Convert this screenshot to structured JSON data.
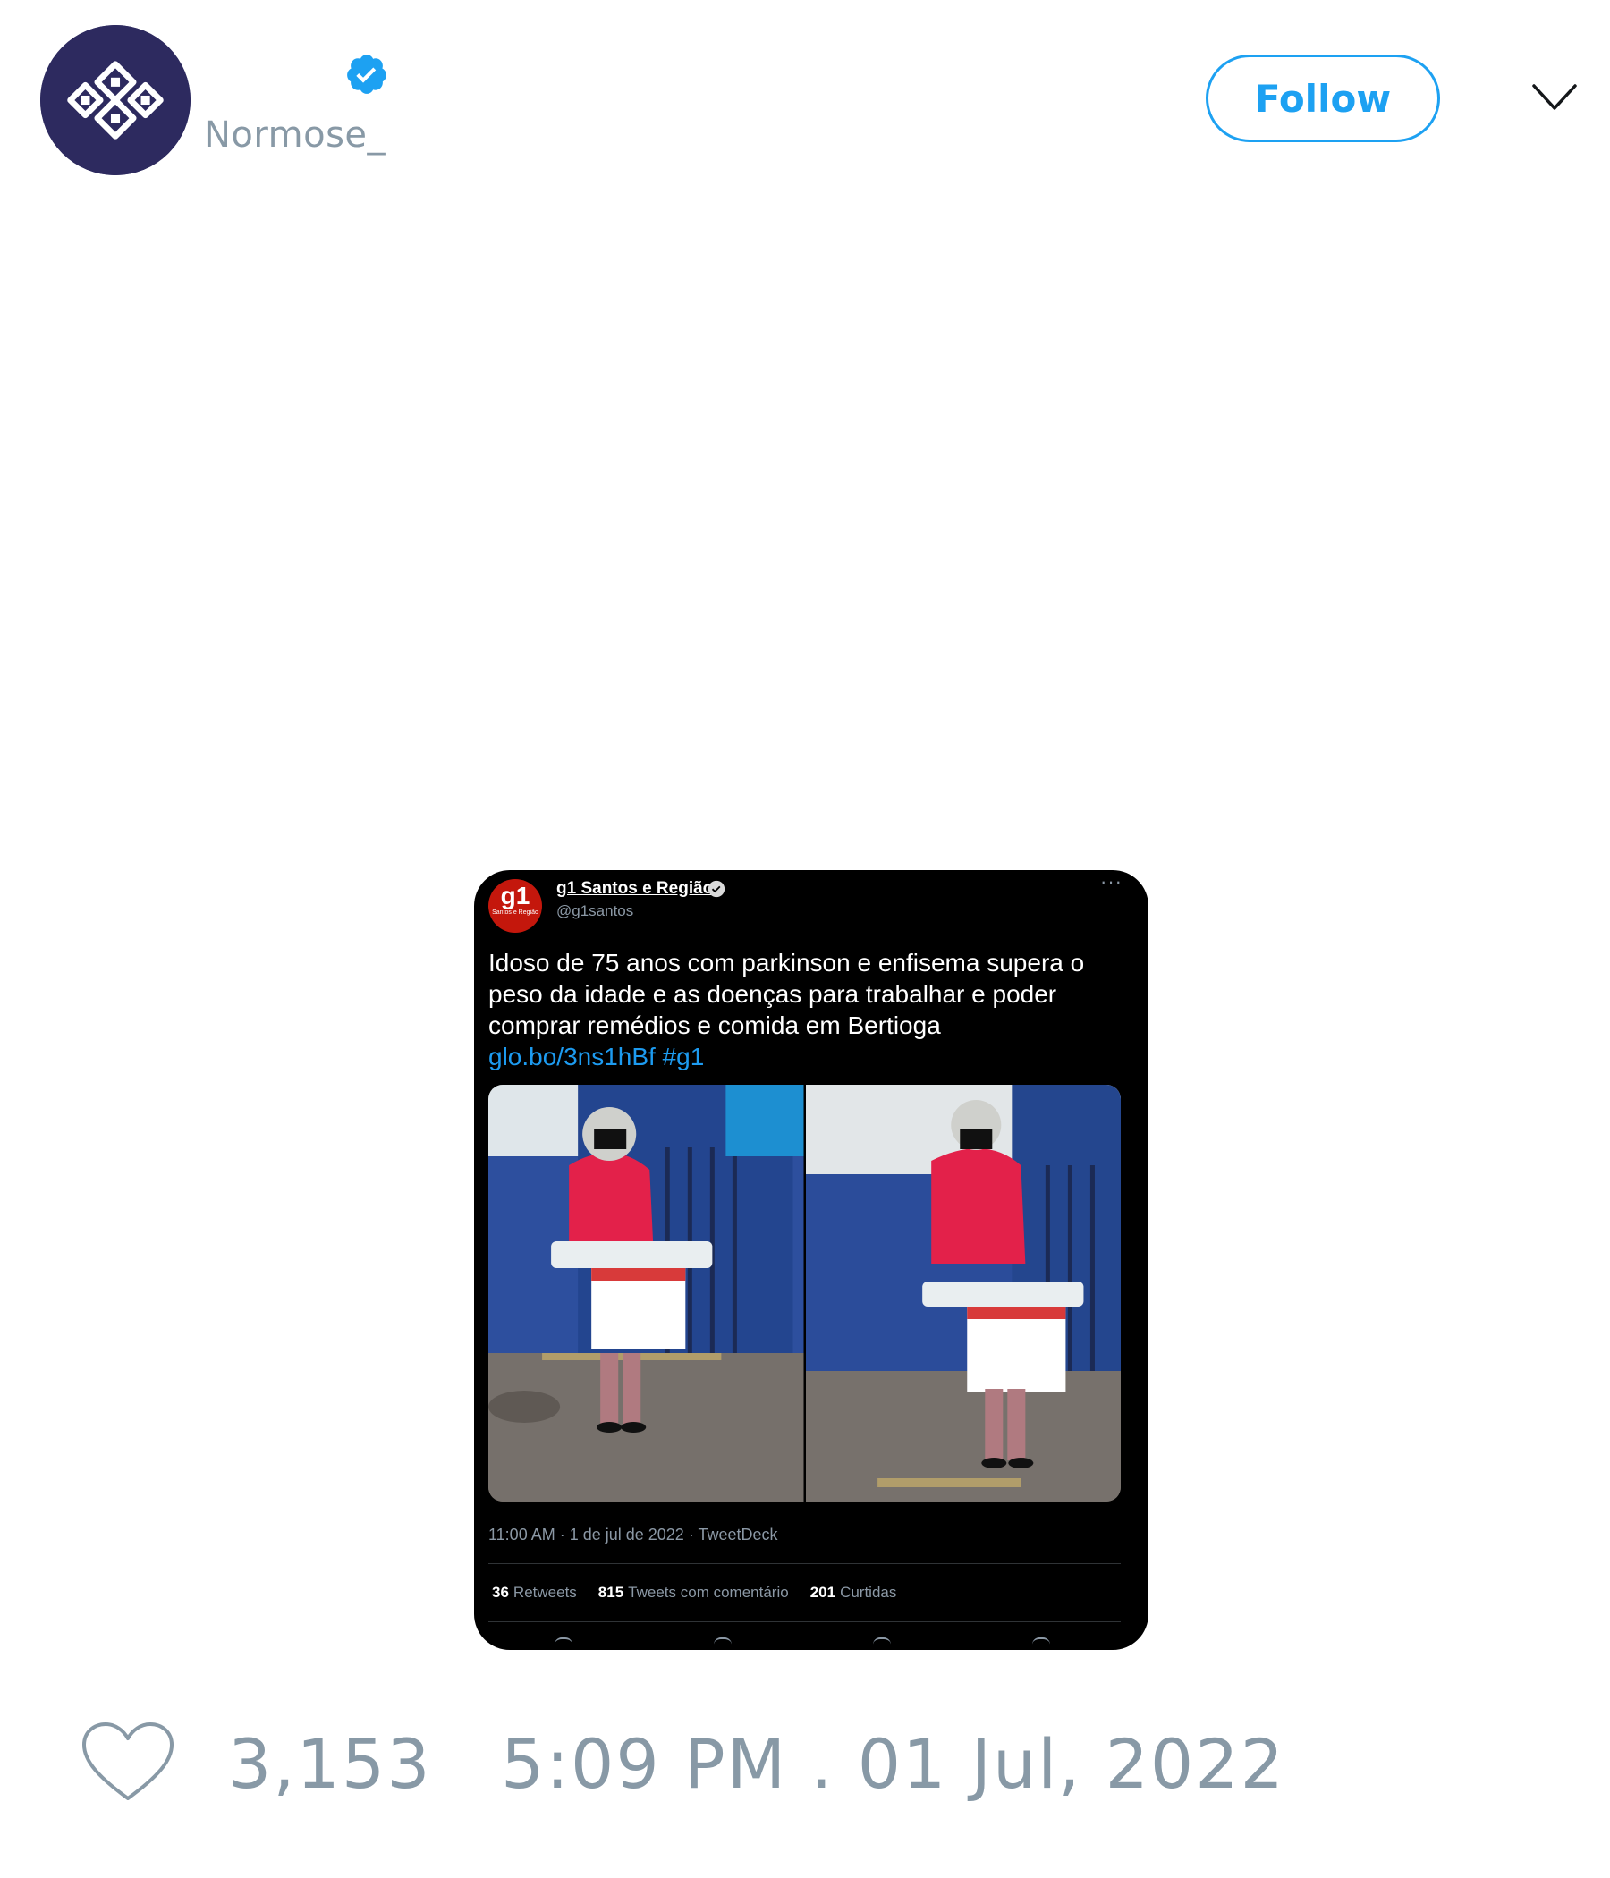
{
  "header": {
    "avatar_icon": "geometric-pattern-logo",
    "display_name": "",
    "handle": "Normose_",
    "verified_icon": "verified-badge-icon",
    "follow_label": "Follow",
    "menu_icon": "chevron-down-icon"
  },
  "embedded_tweet": {
    "logo_text": "g1",
    "logo_subtext": "Santos e Região",
    "name": "g1 Santos e Região",
    "handle": "@g1santos",
    "more_icon": "more-icon",
    "more_text": "···",
    "text": "Idoso de 75 anos com parkinson e enfisema supera o peso da idade e as doenças para trabalhar e poder comprar remédios e comida em Bertioga",
    "link": "glo.bo/3ns1hBf #g1",
    "meta": "11:00 AM · 1 de jul de 2022 · TweetDeck",
    "stats": {
      "retweets_count": "36",
      "retweets_label": "Retweets",
      "quotes_count": "815",
      "quotes_label": "Tweets com comentário",
      "likes_count": "201",
      "likes_label": "Curtidas"
    }
  },
  "footer": {
    "like_icon": "heart-icon",
    "likes": "3,153",
    "timestamp": "5:09 PM . 01 Jul, 2022"
  },
  "colors": {
    "accent": "#1da1f2",
    "muted_text": "#8899a6",
    "avatar_bg": "#2d2a5f",
    "g1_red": "#c4170c"
  }
}
